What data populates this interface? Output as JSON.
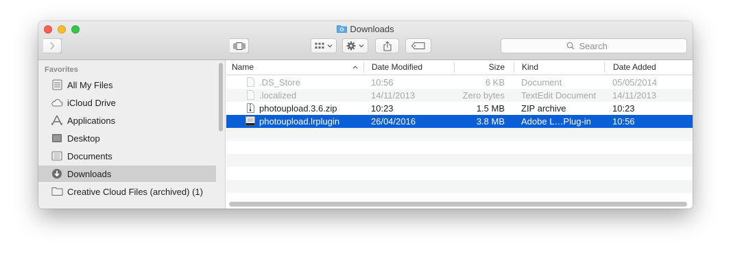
{
  "window": {
    "title": "Downloads"
  },
  "toolbar": {
    "view_modes": [
      "icon",
      "list",
      "column",
      "cover-flow"
    ],
    "active_view": "list",
    "search_placeholder": "Search"
  },
  "sidebar": {
    "heading": "Favorites",
    "items": [
      {
        "label": "All My Files",
        "icon": "all-files-icon"
      },
      {
        "label": "iCloud Drive",
        "icon": "cloud-icon"
      },
      {
        "label": "Applications",
        "icon": "applications-icon"
      },
      {
        "label": "Desktop",
        "icon": "desktop-icon"
      },
      {
        "label": "Documents",
        "icon": "documents-icon"
      },
      {
        "label": "Downloads",
        "icon": "downloads-icon",
        "selected": true
      },
      {
        "label": "Creative Cloud Files (archived) (1)",
        "icon": "folder-icon"
      }
    ]
  },
  "columns": {
    "name": "Name",
    "date_modified": "Date Modified",
    "size": "Size",
    "kind": "Kind",
    "date_added": "Date Added"
  },
  "files": [
    {
      "name": ".DS_Store",
      "date_modified": "10:56",
      "size": "6 KB",
      "kind": "Document",
      "date_added": "05/05/2014",
      "hidden": true
    },
    {
      "name": ".localized",
      "date_modified": "14/11/2013",
      "size": "Zero bytes",
      "kind": "TextEdit Document",
      "date_added": "14/11/2013",
      "hidden": true
    },
    {
      "name": "photoupload.3.6.zip",
      "date_modified": "10:23",
      "size": "1.5 MB",
      "kind": "ZIP archive",
      "date_added": "10:23"
    },
    {
      "name": "photoupload.lrplugin",
      "date_modified": "26/04/2016",
      "size": "3.8 MB",
      "kind": "Adobe L…Plug-in",
      "date_added": "10:56",
      "selected": true
    }
  ],
  "colors": {
    "selection": "#0a5fd6",
    "sidebar_selected": "#cfcfcf"
  }
}
